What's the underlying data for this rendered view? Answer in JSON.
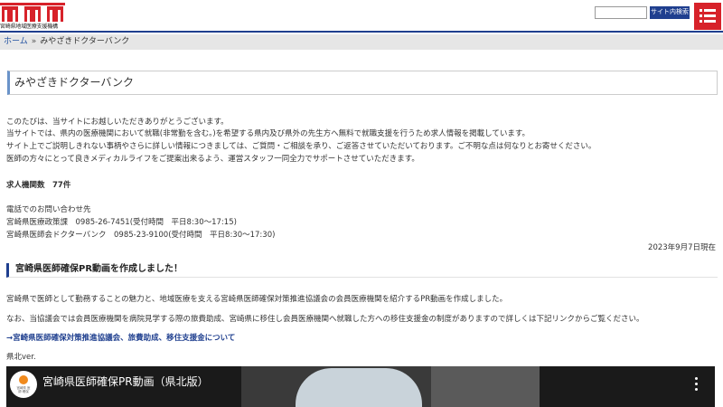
{
  "header": {
    "logo_text": "宮崎県地域医療支援機構",
    "logo_color": "#d7222a",
    "search_placeholder": "",
    "search_button": "サイト内検索",
    "menu_icon": "hamburger-menu-icon",
    "accent_color": "#1f3f8f"
  },
  "breadcrumb": {
    "home": "ホーム",
    "separator": "»",
    "current": "みやざきドクターバンク"
  },
  "page": {
    "title": "みやざきドクターバンク",
    "intro": [
      "このたびは、当サイトにお越しいただきありがとうございます。",
      "当サイトでは、県内の医療機関において就職(非常勤を含む。)を希望する県内及び県外の先生方へ無料で就職支援を行うため求人情報を掲載しています。",
      "サイト上でご説明しきれない事柄やさらに詳しい情報につきましては、ご質問・ご相談を承り、ご返答させていただいております。ご不明な点は何なりとお寄せください。",
      "医師の方々にとって良きメディカルライフをご提案出来るよう、運営スタッフ一同全力でサポートさせていただきます。"
    ],
    "job_count": "求人機関数　77件",
    "contact_heading": "電話でのお問い合わせ先",
    "contact_1": "宮崎県医療政策課　0985-26-7451(受付時間　平日8:30〜17:15)",
    "contact_2": "宮崎県医師会ドクターバンク　0985-23-9100(受付時間　平日8:30〜17:30)",
    "date": "2023年9月7日現在"
  },
  "section": {
    "heading": "宮崎県医師確保PR動画を作成しました！",
    "para_1": "宮崎県で医師として勤務することの魅力と、地域医療を支える宮崎県医師確保対策推進協議会の会員医療機関を紹介するPR動画を作成しました。",
    "para_2": "なお、当協議会では会員医療機関を病院見学する際の旅費助成、宮崎県に移住し会員医療機関へ就職した方への移住支援金の制度がありますので詳しくは下記リンクからご覧ください。",
    "link": "→宮崎県医師確保対策推進協議会、旅費助成、移住支援金について",
    "video_label": "県北ver.",
    "video_title": "宮崎県医師確保PR動画（県北版）",
    "video_channel_label": "宮崎県 医師 確保",
    "video_menu_icon": "more-vertical-icon"
  }
}
